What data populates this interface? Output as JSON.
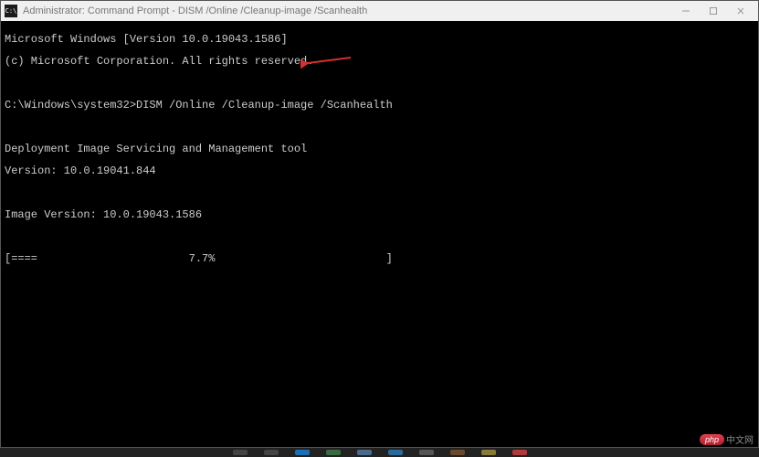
{
  "titlebar": {
    "icon_text": "C:\\",
    "title": "Administrator: Command Prompt - DISM  /Online /Cleanup-image /Scanhealth"
  },
  "terminal": {
    "line1": "Microsoft Windows [Version 10.0.19043.1586]",
    "line2": "(c) Microsoft Corporation. All rights reserved.",
    "blank1": "",
    "prompt_line": "C:\\Windows\\system32>DISM /Online /Cleanup-image /Scanhealth",
    "blank2": "",
    "tool_line": "Deployment Image Servicing and Management tool",
    "version_line": "Version: 10.0.19041.844",
    "blank3": "",
    "image_version": "Image Version: 10.0.19043.1586",
    "blank4": "",
    "progress_line": "[====                       7.7%                          ] "
  },
  "watermark": {
    "badge": "php",
    "text": "中文网"
  }
}
